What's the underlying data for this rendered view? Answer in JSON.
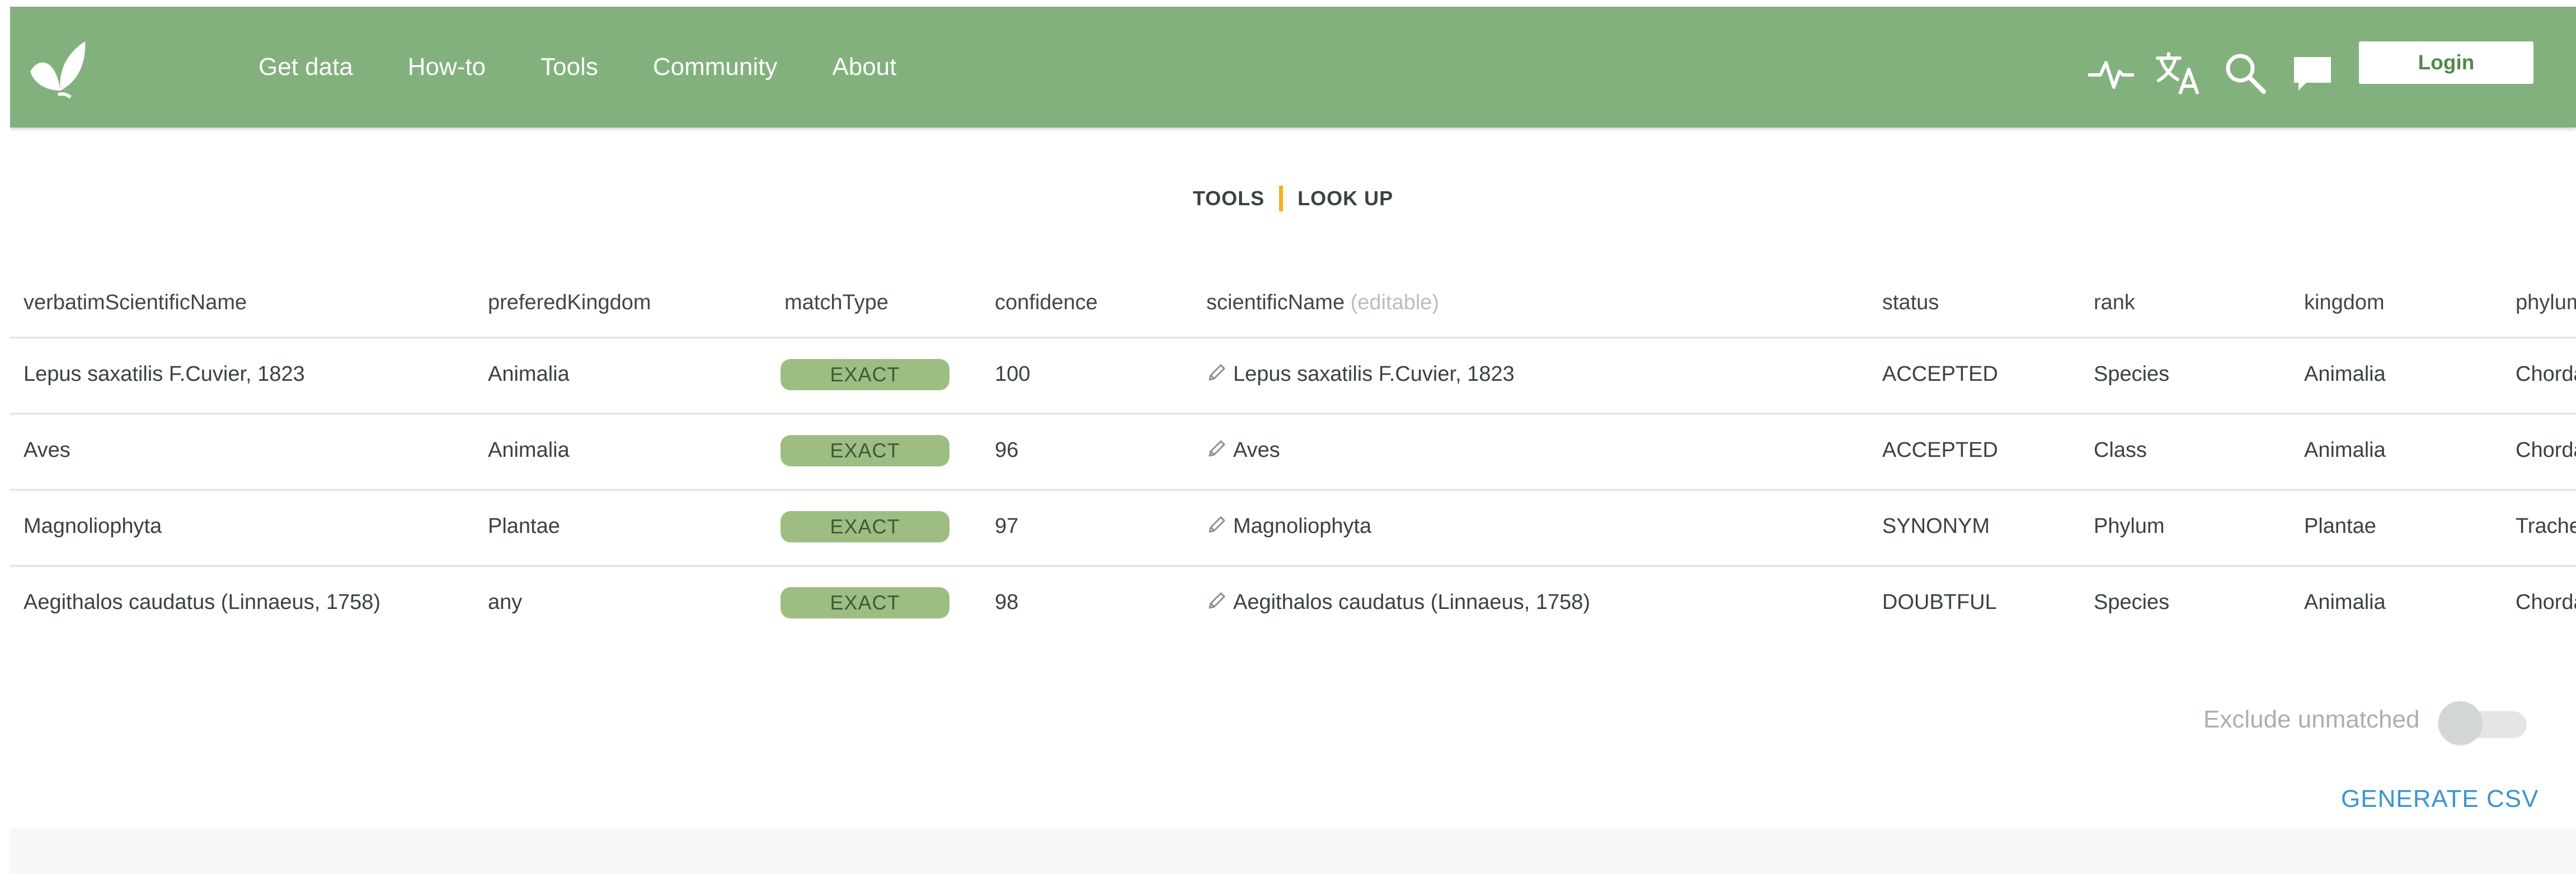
{
  "colors": {
    "header_bg": "#82b17d",
    "accent_separator": "#f2b01e",
    "link": "#3b95cf",
    "badge_bg": "#9ebd82"
  },
  "nav": {
    "logo_icon": "leaf-logo-icon",
    "items": [
      {
        "label": "Get data"
      },
      {
        "label": "How-to"
      },
      {
        "label": "Tools"
      },
      {
        "label": "Community"
      },
      {
        "label": "About"
      }
    ],
    "icons": [
      "activity-pulse-icon",
      "translate-icon",
      "search-icon",
      "chat-bubble-icon"
    ],
    "login_label": "Login"
  },
  "breadcrumb": {
    "parent": "TOOLS",
    "current": "LOOK UP"
  },
  "table": {
    "headers": {
      "verbatim": "verbatimScientificName",
      "kingdom_pref": "preferedKingdom",
      "match": "matchType",
      "confidence": "confidence",
      "sciname": "scientificName",
      "sciname_note": "(editable)",
      "status": "status",
      "rank": "rank",
      "kingdom": "kingdom",
      "phylum": "phylum"
    },
    "rows": [
      {
        "verbatim": "Lepus saxatilis F.Cuvier, 1823",
        "pref": "Animalia",
        "match": "EXACT",
        "confidence": "100",
        "sciname": "Lepus saxatilis F.Cuvier, 1823",
        "status": "ACCEPTED",
        "rank": "Species",
        "kingdom": "Animalia",
        "phylum": "Chordata"
      },
      {
        "verbatim": "Aves",
        "pref": "Animalia",
        "match": "EXACT",
        "confidence": "96",
        "sciname": "Aves",
        "status": "ACCEPTED",
        "rank": "Class",
        "kingdom": "Animalia",
        "phylum": "Chordata"
      },
      {
        "verbatim": "Magnoliophyta",
        "pref": "Plantae",
        "match": "EXACT",
        "confidence": "97",
        "sciname": "Magnoliophyta",
        "status": "SYNONYM",
        "rank": "Phylum",
        "kingdom": "Plantae",
        "phylum": "Tracheophyta"
      },
      {
        "verbatim": "Aegithalos caudatus (Linnaeus, 1758)",
        "pref": "any",
        "match": "EXACT",
        "confidence": "98",
        "sciname": "Aegithalos caudatus (Linnaeus, 1758)",
        "status": "DOUBTFUL",
        "rank": "Species",
        "kingdom": "Animalia",
        "phylum": "Chordata"
      }
    ]
  },
  "controls": {
    "exclude_label": "Exclude unmatched",
    "exclude_on": false,
    "generate_csv": "GENERATE CSV"
  }
}
